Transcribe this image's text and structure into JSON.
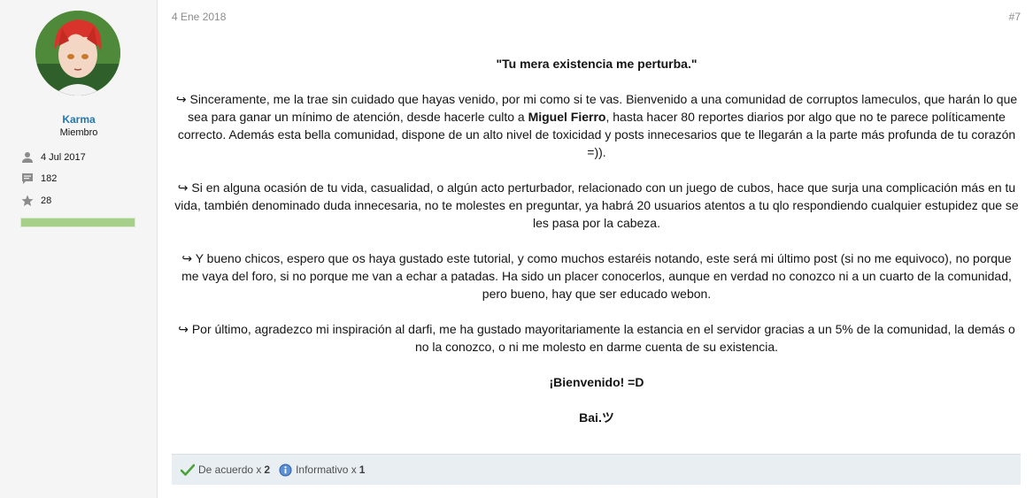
{
  "user": {
    "name": "Karma",
    "title": "Miembro",
    "joined": "4 Jul 2017",
    "messages": "182",
    "points": "28",
    "level_fill": 1.0
  },
  "post": {
    "date": "4 Ene 2018",
    "number": "#7",
    "title": "\"Tu mera existencia me perturba.\"",
    "p1_a": "↪ Sinceramente, me la trae sin cuidado que hayas venido, por mi como si te vas. Bienvenido a una comunidad de corruptos lameculos, que harán lo que sea para ganar un mínimo de atención, desde hacerle culto a ",
    "p1_bold": "Miguel Fierro",
    "p1_b": ", hasta hacer 80 reportes diarios por algo que no te parece políticamente correcto. Además esta bella comunidad, dispone de un alto nivel de toxicidad y posts innecesarios que te llegarán a la parte más profunda de tu corazón =)).",
    "p2": "↪ Si en alguna ocasión de tu vida, casualidad, o algún acto perturbador, relacionado con un juego de cubos, hace que surja una complicación más en tu vida, también denominado duda innecesaria, no te molestes en preguntar, ya habrá 20 usuarios atentos a tu qlo respondiendo cualquier estupidez que se les pasa por la cabeza.",
    "p3": "↪ Y bueno chicos, espero que os haya gustado este tutorial, y como muchos estaréis notando, este será mi último post (si no me equivoco), no porque me vaya del foro, si no porque me van a echar a patadas. Ha sido un placer conocerlos, aunque en verdad no conozco ni a un cuarto de la comunidad, pero bueno, hay que ser educado webon.",
    "p4": "↪ Por último, agradezco mi inspiración al darfi, me ha gustado mayoritariamente la estancia en el servidor gracias a un 5% de la comunidad, la demás o no la conozco, o ni me molesto en darme cuenta de su existencia.",
    "welcome": "¡Bienvenido! =D",
    "bye": "Bai.ツ"
  },
  "reactions": {
    "agree_label": "De acuerdo x",
    "agree_count": "2",
    "informative_label": "Informativo x",
    "informative_count": "1"
  },
  "colors": {
    "username": "#2577b1",
    "level_bar": "#a6d08a",
    "reaction_bar": "#e9eef3"
  }
}
